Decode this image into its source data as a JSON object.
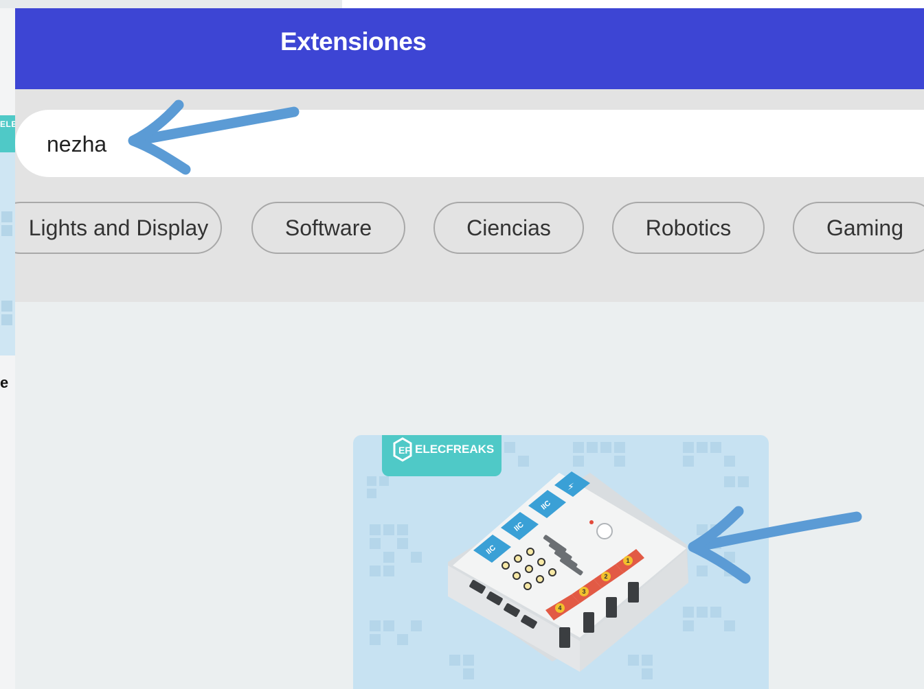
{
  "dialog": {
    "title": "Extensiones"
  },
  "search": {
    "value": "nezha"
  },
  "categories": [
    "Lights and Display",
    "Software",
    "Ciencias",
    "Robotics",
    "Gaming"
  ],
  "background": {
    "partial_text": "e",
    "partial_logo_text": "ELEC"
  },
  "extension_card": {
    "brand_logo": "ELECFREAKS",
    "board_ports": [
      "IIC",
      "IIC",
      "IIC"
    ],
    "port_numbers": [
      "1",
      "2",
      "3",
      "4"
    ]
  },
  "annotations": [
    {
      "name": "arrow-to-search-icon",
      "color": "#5b9bd5"
    },
    {
      "name": "arrow-to-extension-icon",
      "color": "#5b9bd5"
    }
  ],
  "colors": {
    "header": "#3d45d4",
    "accent_arrow": "#5b9bd5",
    "card_bg": "#c7e2f2",
    "logo_bg": "#4fc9c7"
  }
}
